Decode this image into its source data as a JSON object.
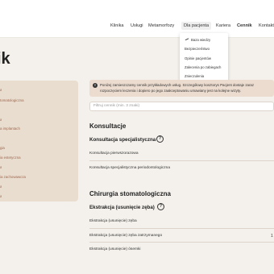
{
  "nav": {
    "items": [
      "Klinika",
      "Usługi",
      "Metamorfozy",
      "Dla pacjenta",
      "Kariera",
      "Cennik",
      "Kontakt"
    ]
  },
  "dropdown": {
    "items": [
      "Baza wiedzy",
      "Bezpieczeństwo",
      "Opinie pacjentów",
      "Zalecenia po zabiegach",
      "Znieczulenia"
    ]
  },
  "page": {
    "title": "ik"
  },
  "sidebar": {
    "items": [
      "a",
      "tomatologiczna",
      "",
      "a",
      "a implantach",
      "",
      "",
      "gia",
      "ia estetyczna",
      "a",
      "ia zachowawcza",
      "a",
      "a"
    ]
  },
  "notice": {
    "text_line1": "Poniżej zamieszczamy cennik przykładowych usług. Szczegółowy kosztorys Pacjent dostaje zaraz",
    "text_line2": "rozpoczęciem leczenia i dopiero po jego zaakceptowaniu umawiany jest na kolejne wizyty."
  },
  "search": {
    "placeholder": "Filtruj cennik (min. 3 znaki)"
  },
  "sections": {
    "konsultacje": {
      "title": "Konsultacje",
      "subtitle": "Konsultacja specjalistyczna",
      "rows": [
        "Konsultacja pierwszorazowa",
        "Konsultacja specjalistyczna periodontologiczna"
      ]
    },
    "chirurgia": {
      "title": "Chirurgia stomatologiczna",
      "subtitle": "Ekstrakcja (usunięcie zęba)",
      "rows": [
        "Ekstrakcja (usunięcie) zęba",
        "Ekstrakcja (usunięcie) zęba zatrzymanego",
        "Ekstrakcja (usunięcie) ósemki"
      ],
      "row_values": [
        "",
        "1",
        ""
      ]
    }
  },
  "colors": {
    "accent": "#a0684e",
    "sidebar_bg": "#e9ddd0",
    "page_bg": "#f4f1ec"
  }
}
